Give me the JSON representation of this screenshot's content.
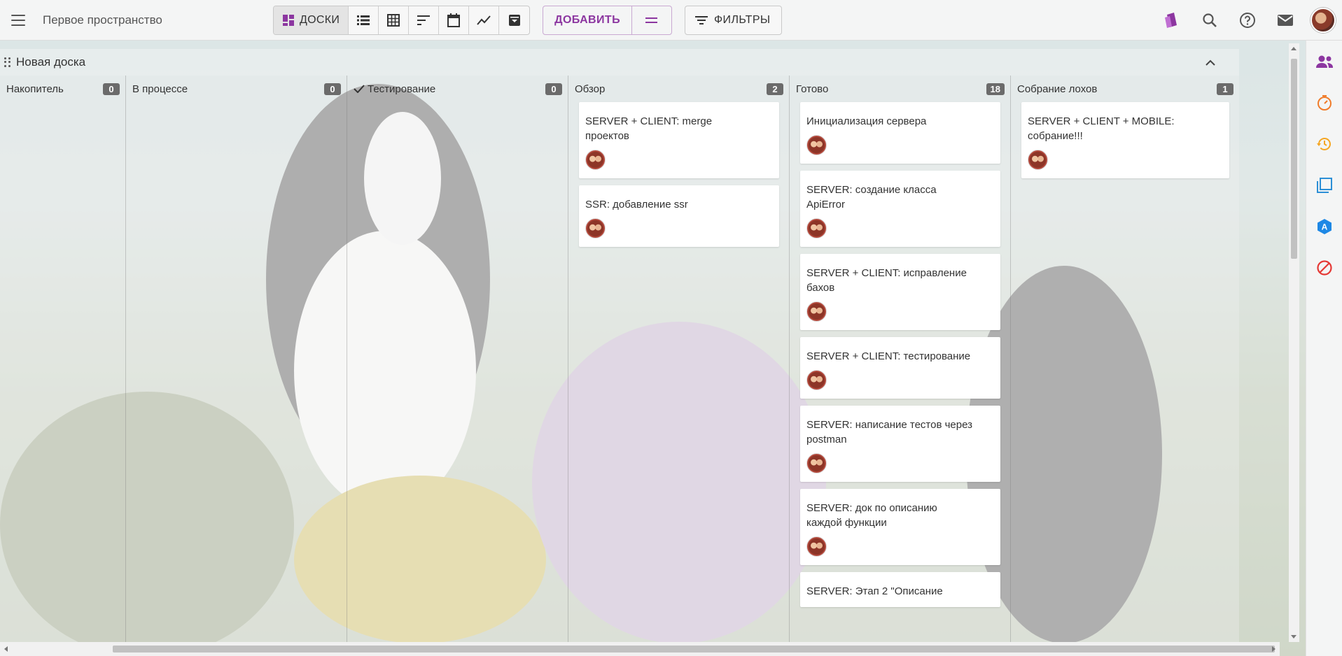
{
  "header": {
    "space_title": "Первое пространство",
    "views": [
      {
        "icon": "boards-icon",
        "label": "ДОСКИ",
        "active": true
      },
      {
        "icon": "list-icon",
        "label": "",
        "active": false
      },
      {
        "icon": "table-icon",
        "label": "",
        "active": false
      },
      {
        "icon": "sort-icon",
        "label": "",
        "active": false
      },
      {
        "icon": "calendar-icon",
        "label": "",
        "active": false
      },
      {
        "icon": "chart-icon",
        "label": "",
        "active": false
      },
      {
        "icon": "archive-icon",
        "label": "",
        "active": false
      }
    ],
    "add_label": "ДОБАВИТЬ",
    "filters_label": "ФИЛЬТРЫ",
    "right_icons": [
      "cards-icon",
      "search-icon",
      "help-icon",
      "mail-icon",
      "user-avatar"
    ]
  },
  "colors": {
    "accent": "#8c36a0",
    "count_badge": "#6b6b6b",
    "rail_people": "#8c36a0",
    "rail_timer": "#f07c2b",
    "rail_history": "#f5a623",
    "rail_copy": "#2c8fd6",
    "rail_translate": "#1e88e5",
    "rail_block": "#e53935"
  },
  "rail_icons": [
    "people-icon",
    "timer-icon",
    "history-icon",
    "copy-icon",
    "translate-icon",
    "block-icon"
  ],
  "board": {
    "title": "Новая доска",
    "columns": [
      {
        "title": "Накопитель",
        "count": "0",
        "done": false,
        "cards": []
      },
      {
        "title": "В процессе",
        "count": "0",
        "done": false,
        "cards": []
      },
      {
        "title": "Тестирование",
        "count": "0",
        "done": true,
        "cards": []
      },
      {
        "title": "Обзор",
        "count": "2",
        "done": false,
        "cards": [
          {
            "title": "SERVER + CLIENT: merge проектов"
          },
          {
            "title": "SSR: добавление ssr"
          }
        ]
      },
      {
        "title": "Готово",
        "count": "18",
        "done": false,
        "cards": [
          {
            "title": "Инициализация сервера"
          },
          {
            "title": "SERVER: создание класса ApiError"
          },
          {
            "title": "SERVER + CLIENT: исправление бахов"
          },
          {
            "title": "SERVER + CLIENT: тестирование"
          },
          {
            "title": "SERVER: написание тестов через postman"
          },
          {
            "title": "SERVER: док по описанию каждой функции"
          },
          {
            "title": "SERVER: Этап 2 \"Описание"
          }
        ]
      },
      {
        "title": "Собрание лохов",
        "count": "1",
        "done": false,
        "cards": [
          {
            "title": "SERVER + CLIENT + MOBILE: собрание!!!"
          }
        ]
      }
    ]
  }
}
